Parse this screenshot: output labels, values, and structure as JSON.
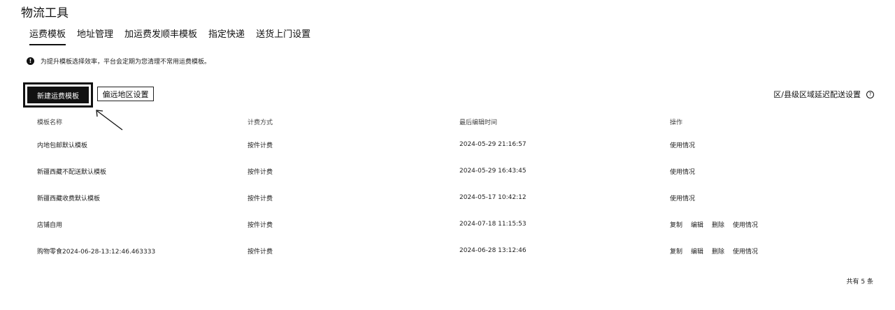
{
  "page": {
    "title": "物流工具"
  },
  "tabs": [
    {
      "label": "运费模板",
      "active": true
    },
    {
      "label": "地址管理",
      "active": false
    },
    {
      "label": "加运费发顺丰模板",
      "active": false
    },
    {
      "label": "指定快递",
      "active": false
    },
    {
      "label": "送货上门设置",
      "active": false
    }
  ],
  "notice": {
    "icon": "alert-icon",
    "text": "为提升模板选择效率，平台会定期为您清理不常用运费模板。"
  },
  "toolbar": {
    "new_template_label": "新建运费模板",
    "remote_area_label": "偏远地区设置",
    "region_delay_label": "区/县级区域延迟配送设置"
  },
  "table": {
    "headers": {
      "name": "模板名称",
      "billing": "计费方式",
      "updated": "最后编辑时间",
      "actions": "操作"
    },
    "rows": [
      {
        "name": "内地包邮默认模板",
        "billing": "按件计费",
        "updated": "2024-05-29 21:16:57",
        "actions": [
          "使用情况"
        ]
      },
      {
        "name": "新疆西藏不配送默认模板",
        "billing": "按件计费",
        "updated": "2024-05-29 16:43:45",
        "actions": [
          "使用情况"
        ]
      },
      {
        "name": "新疆西藏收费默认模板",
        "billing": "按件计费",
        "updated": "2024-05-17 10:42:12",
        "actions": [
          "使用情况"
        ]
      },
      {
        "name": "店铺自用",
        "billing": "按件计费",
        "updated": "2024-07-18 11:15:53",
        "actions": [
          "复制",
          "编辑",
          "删除",
          "使用情况"
        ]
      },
      {
        "name": "购物零食2024-06-28-13:12:46.463333",
        "billing": "按件计费",
        "updated": "2024-06-28 13:12:46",
        "actions": [
          "复制",
          "编辑",
          "删除",
          "使用情况"
        ]
      }
    ]
  },
  "footer": {
    "total_label": "共有 5 条"
  }
}
